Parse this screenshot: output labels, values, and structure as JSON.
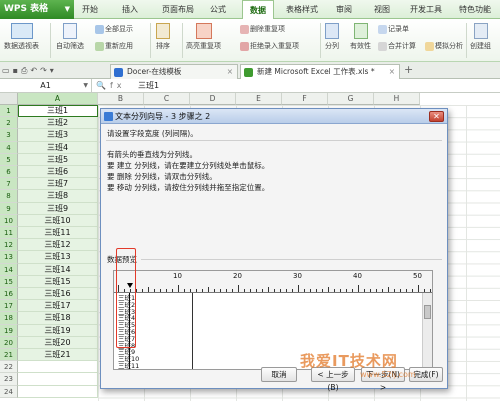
{
  "app": {
    "name": "WPS 表格"
  },
  "menu": [
    "开始",
    "插入",
    "页面布局",
    "公式",
    "数据",
    "表格样式",
    "审阅",
    "视图",
    "开发工具",
    "特色功能"
  ],
  "active_menu": "数据",
  "ribbon": {
    "pivot": "数据透视表",
    "autofilter": "自动筛选",
    "showall": "全部显示",
    "reapply": "重新应用",
    "sort": "排序",
    "highlight_dup": "高亮重复项",
    "delete_dup": "删除重复项",
    "reject_dup": "拒绝录入重复项",
    "split": "分列",
    "validity": "有效性",
    "record": "记录单",
    "merge_calc": "合并计算",
    "simulate": "模拟分析",
    "create_group": "创建组"
  },
  "tabs": [
    {
      "label": "Docer-在线模板"
    },
    {
      "label": "新建 Microsoft Excel 工作表.xls *"
    }
  ],
  "formula_bar": {
    "name_box": "A1",
    "value": "三班1"
  },
  "columns": [
    "A",
    "B",
    "C",
    "D",
    "E",
    "F",
    "G",
    "H"
  ],
  "rows": [
    {
      "n": "1",
      "a": "三班1"
    },
    {
      "n": "2",
      "a": "三班2"
    },
    {
      "n": "3",
      "a": "三班3"
    },
    {
      "n": "4",
      "a": "三班4"
    },
    {
      "n": "5",
      "a": "三班5"
    },
    {
      "n": "6",
      "a": "三班6"
    },
    {
      "n": "7",
      "a": "三班7"
    },
    {
      "n": "8",
      "a": "三班8"
    },
    {
      "n": "9",
      "a": "三班9"
    },
    {
      "n": "10",
      "a": "三班10"
    },
    {
      "n": "11",
      "a": "三班11"
    },
    {
      "n": "12",
      "a": "三班12"
    },
    {
      "n": "13",
      "a": "三班13"
    },
    {
      "n": "14",
      "a": "三班14"
    },
    {
      "n": "15",
      "a": "三班15"
    },
    {
      "n": "16",
      "a": "三班16"
    },
    {
      "n": "17",
      "a": "三班17"
    },
    {
      "n": "18",
      "a": "三班18"
    },
    {
      "n": "19",
      "a": "三班19"
    },
    {
      "n": "20",
      "a": "三班20"
    },
    {
      "n": "21",
      "a": "三班21"
    },
    {
      "n": "22",
      "a": ""
    },
    {
      "n": "23",
      "a": ""
    },
    {
      "n": "24",
      "a": ""
    }
  ],
  "dialog": {
    "title": "文本分列向导 - 3 步骤之 2",
    "subtitle": "请设置字段宽度 (列间隔)。",
    "instr_header": "有箭头的垂直线为分列线。",
    "instr1": "要 建立 分列线，请在要建立分列线处单击鼠标。",
    "instr2": "要 删除 分列线，请双击分列线。",
    "instr3": "要 移动 分列线，请按住分列线并拖至指定位置。",
    "preview_label": "数据预览",
    "ruler_labels": [
      "10",
      "20",
      "30",
      "40",
      "50"
    ],
    "preview_rows": [
      "三班1",
      "三班2",
      "三班3",
      "三班4",
      "三班5",
      "三班6",
      "三班7",
      "三班8",
      "三班9",
      "三班10",
      "三班11"
    ],
    "buttons": {
      "cancel": "取消",
      "back": "< 上一步(B)",
      "next": "下一步(N) >",
      "finish": "完成(F)"
    }
  },
  "watermark": {
    "line1": "我爱IT技术网",
    "line2": "www.52ij.com"
  }
}
